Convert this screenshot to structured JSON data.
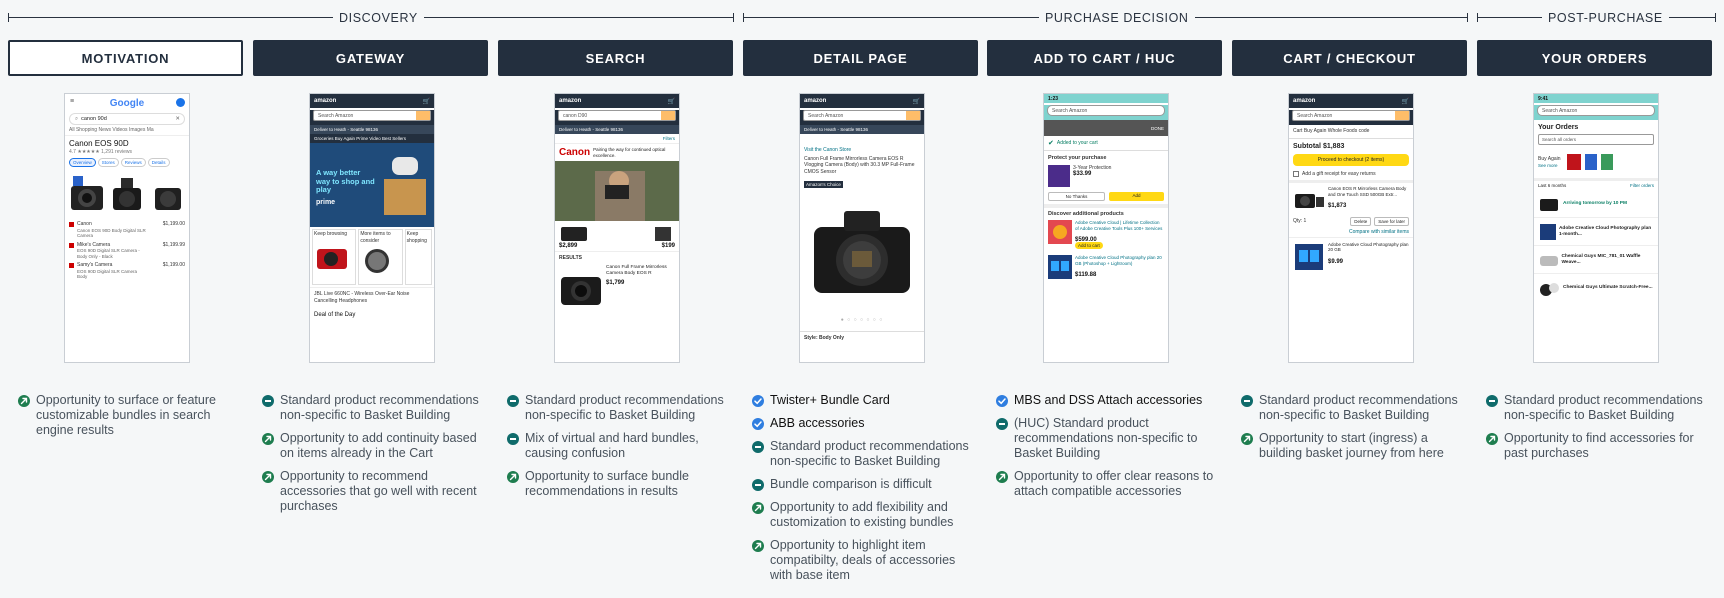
{
  "phases": [
    {
      "title": "DISCOVERY"
    },
    {
      "title": "PURCHASE DECISION"
    },
    {
      "title": "POST-PURCHASE"
    }
  ],
  "stages": [
    {
      "label": "MOTIVATION",
      "active": true
    },
    {
      "label": "GATEWAY",
      "active": false
    },
    {
      "label": "SEARCH",
      "active": false
    },
    {
      "label": "DETAIL PAGE",
      "active": false
    },
    {
      "label": "ADD TO CART / HUC",
      "active": false
    },
    {
      "label": "CART / CHECKOUT",
      "active": false
    },
    {
      "label": "YOUR ORDERS",
      "active": false
    }
  ],
  "screens": {
    "google": {
      "logo": "Google",
      "query": "canon 90d",
      "tabs": "All   Shopping   News   Videos   Images   Ma",
      "title": "Canon EOS 90D",
      "rating": "4.7 ★★★★★ 1,291 reviews",
      "chips": [
        "Overview",
        "Stores",
        "Reviews",
        "Details"
      ],
      "listings": [
        {
          "store": "Canon",
          "desc": "Canon EOS 90D Body Digital SLR Camera",
          "price": "$1,199.00"
        },
        {
          "store": "Mike's Camera",
          "desc": "EOS 90D Digital SLR Camera - Body Only - Black",
          "price": "$1,199.99"
        },
        {
          "store": "Samy's Camera",
          "desc": "EOS 90D Digital SLR Camera Body",
          "price": "$1,199.00"
        }
      ]
    },
    "gateway": {
      "brand": "amazon",
      "search": "Search Amazon",
      "deliver": "Deliver to Heath - Seattle 98136",
      "nav": "Groceries   Buy Again   Prime   Video   Best Sellers",
      "hero": "A way better way to shop and play",
      "hero_brand": "prime",
      "cards": [
        "Keep browsing",
        "More items to consider",
        "Keep shopping"
      ],
      "promo": "JBL Live 660NC - Wireless Over-Ear Noise Cancelling Headphones",
      "deal": "Deal of the Day"
    },
    "search": {
      "brand": "amazon",
      "query": "canon D90",
      "deliver": "Deliver to Heath - Seattle 98136",
      "filters": "Filters",
      "ad_brand": "Canon",
      "ad_text": "Pairing the way for continued optical excellence.",
      "price1": "$2,899",
      "price2": "$199",
      "results_label": "RESULTS",
      "result_title": "Canon Full Frame Mirrorless Camera Body EOS R",
      "result_price": "$1,799"
    },
    "detail": {
      "brand": "amazon",
      "search": "Search Amazon",
      "deliver": "Deliver to Heath - Seattle 98136",
      "store_link": "Visit the Canon Store",
      "title": "Canon Full Frame Mirrorless Camera EOS R Vlogging Camera (Body) with 30.3 MP Full-Frame CMOS Sensor",
      "badge": "Amazon's Choice",
      "style": "Style:  Body Only"
    },
    "huc": {
      "time": "1:23",
      "search": "Search Amazon",
      "added": "Added to your cart",
      "done": "DONE",
      "protect": "Protect your purchase",
      "protect_item": "3-Year Protection",
      "protect_price": "$33.99",
      "no_thanks": "No Thanks",
      "add": "Add",
      "discover": "Discover additional products",
      "prod1": "Adobe Creative Cloud | Lifetime Collection of Adobe Creative Tools Plus 100+ Services",
      "prod1_price": "$599.00",
      "add_to_cart": "Add to cart",
      "prod2": "Adobe Creative Cloud Photography plan 20 GB (Photoshop + Lightroom)",
      "prod2_price": "$119.88"
    },
    "cart": {
      "brand": "amazon",
      "search": "Search Amazon",
      "tabs": "Cart   Buy Again   Whole Foods code",
      "subtotal": "Subtotal $1,883",
      "checkout": "Proceed to checkout (2 items)",
      "gift": "Add a gift receipt for easy returns",
      "item1": "Canon EOS R Mirrorless Camera Body and One Touch SSD 500GB Extr...",
      "item1_price": "$1,873",
      "qty": "Qty: 1",
      "delete": "Delete",
      "save": "Save for later",
      "compare": "Compare with similar items",
      "item2": "Adobe Creative Cloud Photography plan 20 GB",
      "item2_price": "$9.99"
    },
    "orders": {
      "time": "9:41",
      "search": "Search Amazon",
      "title": "Your Orders",
      "search_orders": "Search all orders",
      "buy_again": "Buy Again",
      "see_more": "See more",
      "period": "Last 6 months",
      "filter": "Filter orders",
      "o1": "Arriving tomorrow by 10 PM",
      "o2": "Adobe Creative Cloud Photography plan 1-month...",
      "o3": "Chemical Guys MIC_781_01 Waffle Weave...",
      "o4": "Chemical Guys Ultimate Scratch-Free..."
    }
  },
  "notes": [
    [
      {
        "icon": "arrow",
        "text": "Opportunity to surface or feature customizable bundles in search engine results"
      }
    ],
    [
      {
        "icon": "dash",
        "text": "Standard product recommendations non-specific to Basket Building"
      },
      {
        "icon": "arrow",
        "text": "Opportunity to add continuity based on items already in the Cart"
      },
      {
        "icon": "arrow",
        "text": "Opportunity to recommend accessories that go well with recent purchases"
      }
    ],
    [
      {
        "icon": "dash",
        "text": "Standard product recommendations non-specific to Basket Building"
      },
      {
        "icon": "dash",
        "text": "Mix of virtual and hard bundles, causing confusion"
      },
      {
        "icon": "arrow",
        "text": "Opportunity to surface bundle recommendations in results"
      }
    ],
    [
      {
        "icon": "check",
        "text": "Twister+ Bundle Card"
      },
      {
        "icon": "check",
        "text": "ABB accessories"
      },
      {
        "icon": "dash",
        "text": "Standard product recommendations non-specific to Basket Building"
      },
      {
        "icon": "dash",
        "text": "Bundle comparison is difficult"
      },
      {
        "icon": "arrow",
        "text": "Opportunity to add flexibility and customization to existing bundles"
      },
      {
        "icon": "arrow",
        "text": "Opportunity to highlight item compatibilty, deals of accessories with base item"
      }
    ],
    [
      {
        "icon": "check",
        "text": "MBS and DSS Attach accessories"
      },
      {
        "icon": "dash",
        "text": "(HUC) Standard product recommendations non-specific to Basket Building"
      },
      {
        "icon": "arrow",
        "text": "Opportunity to offer clear reasons to attach compatible accessories"
      }
    ],
    [
      {
        "icon": "dash",
        "text": "Standard product recommendations non-specific to Basket Building"
      },
      {
        "icon": "arrow",
        "text": "Opportunity to start (ingress) a building basket journey from here"
      }
    ],
    [
      {
        "icon": "dash",
        "text": "Standard product recommendations non-specific to Basket Building"
      },
      {
        "icon": "arrow",
        "text": "Opportunity to find accessories for past purchases"
      }
    ]
  ]
}
